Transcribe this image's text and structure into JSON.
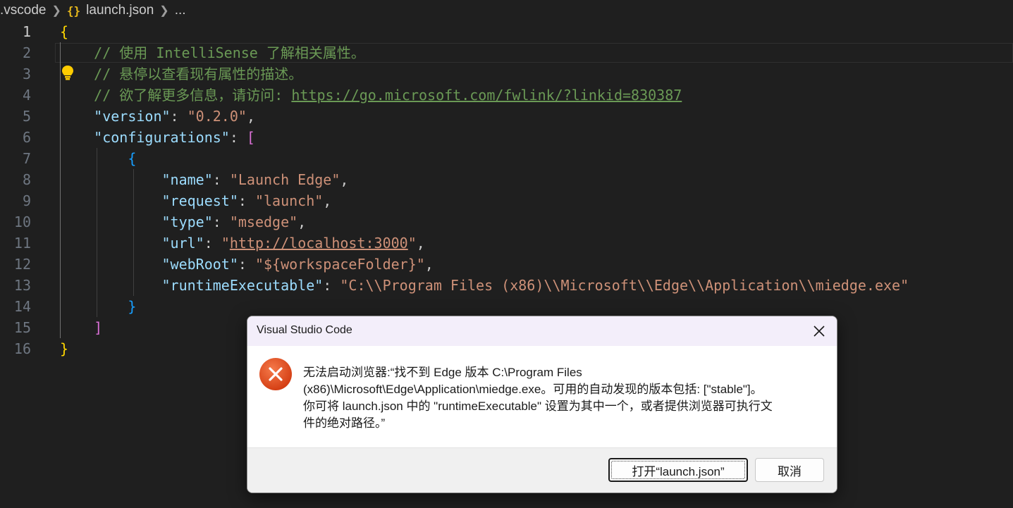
{
  "breadcrumb": {
    "folder": ".vscode",
    "file_icon": "{}",
    "file": "launch.json",
    "more": "..."
  },
  "editor": {
    "current_line": 1,
    "lines": [
      {
        "n": "1"
      },
      {
        "n": "2"
      },
      {
        "n": "3"
      },
      {
        "n": "4"
      },
      {
        "n": "5"
      },
      {
        "n": "6"
      },
      {
        "n": "7"
      },
      {
        "n": "8"
      },
      {
        "n": "9"
      },
      {
        "n": "10"
      },
      {
        "n": "11"
      },
      {
        "n": "12"
      },
      {
        "n": "13"
      },
      {
        "n": "14"
      },
      {
        "n": "15"
      },
      {
        "n": "16"
      }
    ],
    "code": {
      "l1_open": "{",
      "l2_comment": "// 使用 IntelliSense 了解相关属性。",
      "l3_comment": "// 悬停以查看现有属性的描述。",
      "l4_comment": "// 欲了解更多信息，请访问: ",
      "l4_link": "https://go.microsoft.com/fwlink/?linkid=830387",
      "version_key": "\"version\"",
      "version_val": "\"0.2.0\"",
      "configs_key": "\"configurations\"",
      "configs_open": "[",
      "obj_open": "{",
      "name_key": "\"name\"",
      "name_val": "\"Launch Edge\"",
      "request_key": "\"request\"",
      "request_val": "\"launch\"",
      "type_key": "\"type\"",
      "type_val": "\"msedge\"",
      "url_key": "\"url\"",
      "url_q1": "\"",
      "url_val": "http://localhost:3000",
      "url_q2": "\"",
      "webroot_key": "\"webRoot\"",
      "webroot_val": "\"${workspaceFolder}\"",
      "runtime_key": "\"runtimeExecutable\"",
      "runtime_val": "\"C:\\\\Program Files (x86)\\\\Microsoft\\\\Edge\\\\Application\\\\miedge.exe\"",
      "obj_close": "}",
      "configs_close": "]",
      "l16_close": "}"
    }
  },
  "dialog": {
    "title": "Visual Studio Code",
    "close_label": "×",
    "icon": "error-icon",
    "message_lines": [
      "无法启动浏览器:“找不到 Edge 版本 C:\\Program Files",
      "(x86)\\Microsoft\\Edge\\Application\\miedge.exe。可用的自动发现的版本包括: [\"stable\"]。",
      "你可将 launch.json 中的 \"runtimeExecutable\" 设置为其中一个，或者提供浏览器可执行文",
      "件的绝对路径。”"
    ],
    "primary_button": "打开“launch.json”",
    "secondary_button": "取消"
  },
  "colors": {
    "background": "#1f1f1f",
    "comment": "#6a9955",
    "key": "#9cdcfe",
    "string": "#ce9178",
    "brace_gold": "#ffd700",
    "brace_blue": "#179fff",
    "bracket_purple": "#da70d6",
    "error_red": "#e04a1b"
  }
}
